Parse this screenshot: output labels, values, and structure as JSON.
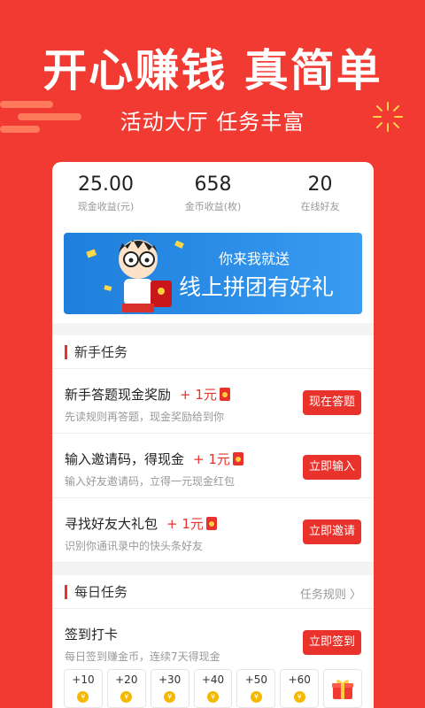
{
  "header": {
    "headline": "开心赚钱  真简单",
    "subline": "活动大厅  任务丰富"
  },
  "stats": [
    {
      "value": "25.00",
      "label": "现金收益(元)"
    },
    {
      "value": "658",
      "label": "金币收益(枚)"
    },
    {
      "value": "20",
      "label": "在线好友"
    }
  ],
  "banner": {
    "line1": "你来我就送",
    "line2": "线上拼团有好礼",
    "colors": {
      "background": "#2d8fe8"
    }
  },
  "newbie": {
    "title": "新手任务",
    "tasks": [
      {
        "title": "新手答题现金奖励",
        "reward": "+ 1元",
        "desc": "先读规则再答题，现金奖励给到你",
        "button": "现在答题"
      },
      {
        "title": "输入邀请码，得现金",
        "reward": "+ 1元",
        "desc": "输入好友邀请码，立得一元现金红包",
        "button": "立即输入"
      },
      {
        "title": "寻找好友大礼包",
        "reward": "+ 1元",
        "desc": "识别你通讯录中的快头条好友",
        "button": "立即邀请"
      }
    ]
  },
  "daily": {
    "title": "每日任务",
    "rules_link": "任务规则 〉",
    "checkin": {
      "title": "签到打卡",
      "desc": "每日签到赚金币，连续7天得现金",
      "button": "立即签到",
      "days": [
        "+10",
        "+20",
        "+30",
        "+40",
        "+50",
        "+60"
      ],
      "coin_symbol": "¥"
    }
  },
  "colors": {
    "primary": "#f03a32",
    "accent": "#e8322b"
  }
}
